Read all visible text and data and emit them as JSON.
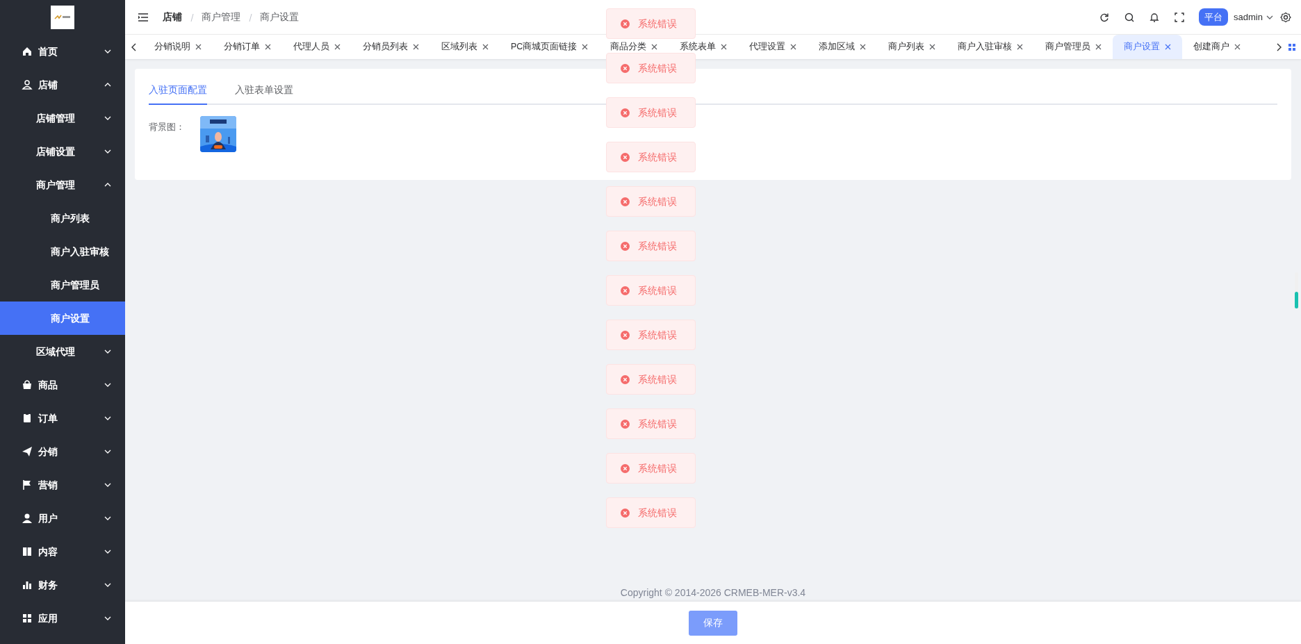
{
  "header": {
    "breadcrumb": [
      "店铺",
      "商户管理",
      "商户设置"
    ],
    "platform_badge": "平台",
    "user": "sadmin"
  },
  "sidebar": {
    "items": [
      {
        "label": "首页",
        "expanded": false
      },
      {
        "label": "店铺",
        "expanded": true,
        "children": [
          {
            "label": "店铺管理",
            "expanded": false
          },
          {
            "label": "店铺设置",
            "expanded": false
          },
          {
            "label": "商户管理",
            "expanded": true,
            "children": [
              {
                "label": "商户列表",
                "selected": false
              },
              {
                "label": "商户入驻审核",
                "selected": false
              },
              {
                "label": "商户管理员",
                "selected": false
              },
              {
                "label": "商户设置",
                "selected": true
              }
            ]
          },
          {
            "label": "区域代理",
            "expanded": false
          }
        ]
      },
      {
        "label": "商品",
        "expanded": false
      },
      {
        "label": "订单",
        "expanded": false
      },
      {
        "label": "分销",
        "expanded": false
      },
      {
        "label": "营销",
        "expanded": false
      },
      {
        "label": "用户",
        "expanded": false
      },
      {
        "label": "内容",
        "expanded": false
      },
      {
        "label": "财务",
        "expanded": false
      },
      {
        "label": "应用",
        "expanded": false
      }
    ]
  },
  "tabs": [
    {
      "label": "分销说明",
      "selected": false
    },
    {
      "label": "分销订单",
      "selected": false
    },
    {
      "label": "代理人员",
      "selected": false
    },
    {
      "label": "分销员列表",
      "selected": false
    },
    {
      "label": "区域列表",
      "selected": false
    },
    {
      "label": "PC商城页面链接",
      "selected": false
    },
    {
      "label": "商品分类",
      "selected": false
    },
    {
      "label": "系统表单",
      "selected": false
    },
    {
      "label": "代理设置",
      "selected": false
    },
    {
      "label": "添加区域",
      "selected": false
    },
    {
      "label": "商户列表",
      "selected": false
    },
    {
      "label": "商户入驻审核",
      "selected": false
    },
    {
      "label": "商户管理员",
      "selected": false
    },
    {
      "label": "商户设置",
      "selected": true
    },
    {
      "label": "创建商户",
      "selected": false
    }
  ],
  "page_tabs": [
    {
      "label": "入驻页面配置",
      "selected": true
    },
    {
      "label": "入驻表单设置",
      "selected": false
    }
  ],
  "form": {
    "label": "背景图："
  },
  "toasts": [
    {
      "text": "系统错误"
    },
    {
      "text": "系统错误"
    },
    {
      "text": "系统错误"
    },
    {
      "text": "系统错误"
    },
    {
      "text": "系统错误"
    },
    {
      "text": "系统错误"
    },
    {
      "text": "系统错误"
    },
    {
      "text": "系统错误"
    },
    {
      "text": "系统错误"
    },
    {
      "text": "系统错误"
    },
    {
      "text": "系统错误"
    },
    {
      "text": "系统错误"
    }
  ],
  "footer": {
    "copyright": "Copyright © 2014-2026 CRMEB-MER-v3.4",
    "save_button": "保存"
  }
}
